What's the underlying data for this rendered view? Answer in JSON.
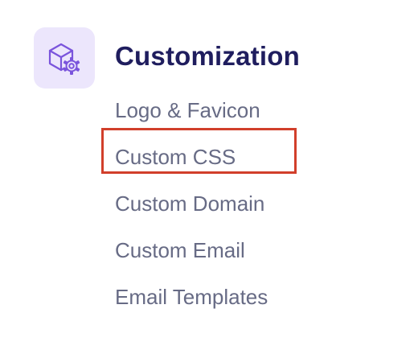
{
  "section": {
    "title": "Customization",
    "icon": "box-gear-icon",
    "icon_bg": "#ece6fc",
    "icon_color": "#7a54dc"
  },
  "menu": {
    "items": [
      {
        "label": "Logo & Favicon"
      },
      {
        "label": "Custom CSS",
        "highlighted": true
      },
      {
        "label": "Custom Domain"
      },
      {
        "label": "Custom Email"
      },
      {
        "label": "Email Templates"
      }
    ]
  },
  "colors": {
    "title": "#1f1d5e",
    "item_text": "#676b85",
    "highlight_border": "#d13f2b"
  }
}
